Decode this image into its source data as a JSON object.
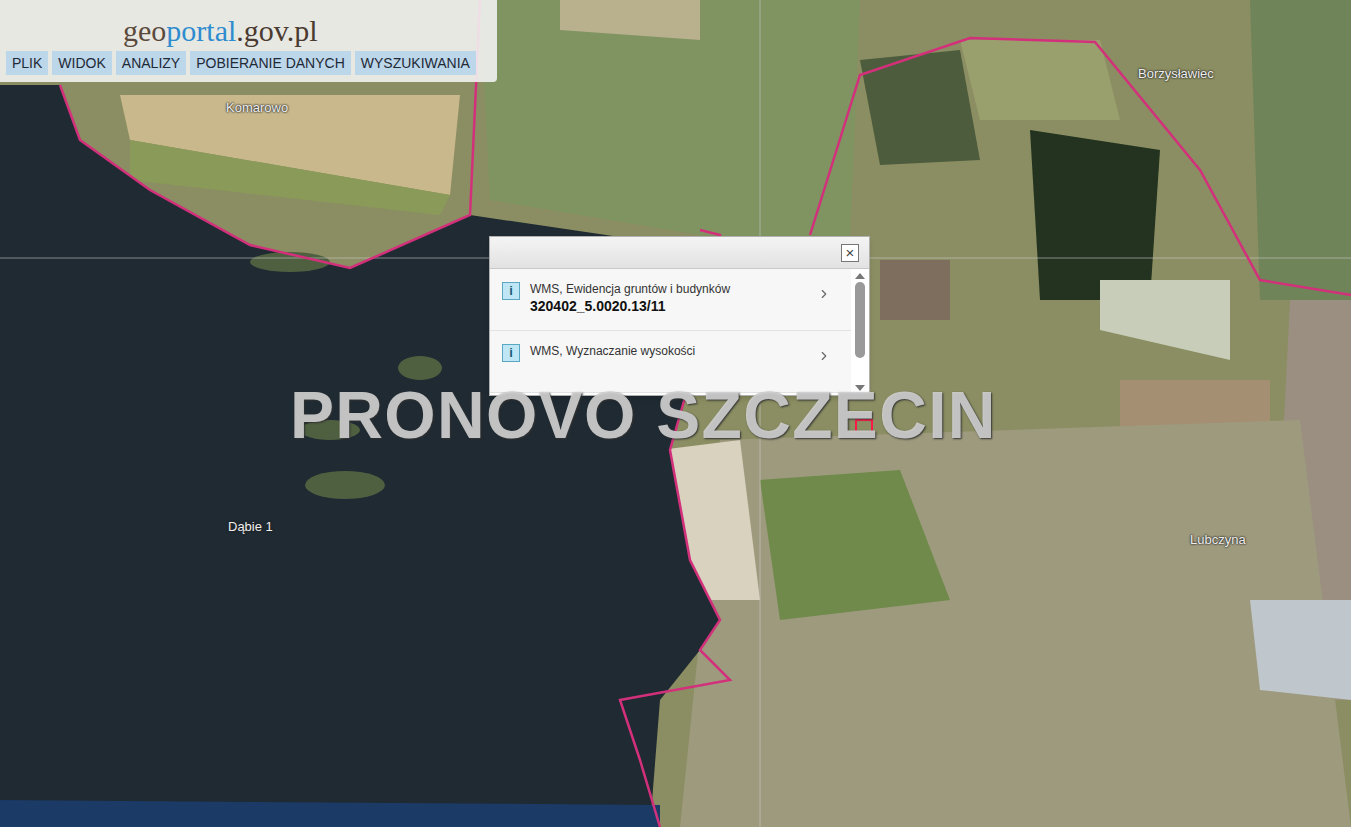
{
  "header": {
    "logo": [
      {
        "text": "geo",
        "color": "#5b4a3c"
      },
      {
        "text": "portal",
        "color": "#2e8ccf"
      },
      {
        "text": ".gov.pl",
        "color": "#4a3a30"
      }
    ],
    "menu": [
      "PLIK",
      "WIDOK",
      "ANALIZY",
      "POBIERANIE DANYCH",
      "WYSZUKIWANIA"
    ]
  },
  "map": {
    "places": [
      {
        "name": "Komarowo"
      },
      {
        "name": "Borzysławiec"
      },
      {
        "name": "Dąbie 1"
      },
      {
        "name": "Lubczyna"
      }
    ]
  },
  "watermark": "PRONOVO SZCZECIN",
  "popup": {
    "close": "×",
    "items": [
      {
        "icon": "i",
        "source": "WMS, Ewidencja gruntów i budynków",
        "value": "320402_5.0020.13/11"
      },
      {
        "icon": "i",
        "source": "WMS, Wyznaczanie wysokości"
      }
    ]
  }
}
